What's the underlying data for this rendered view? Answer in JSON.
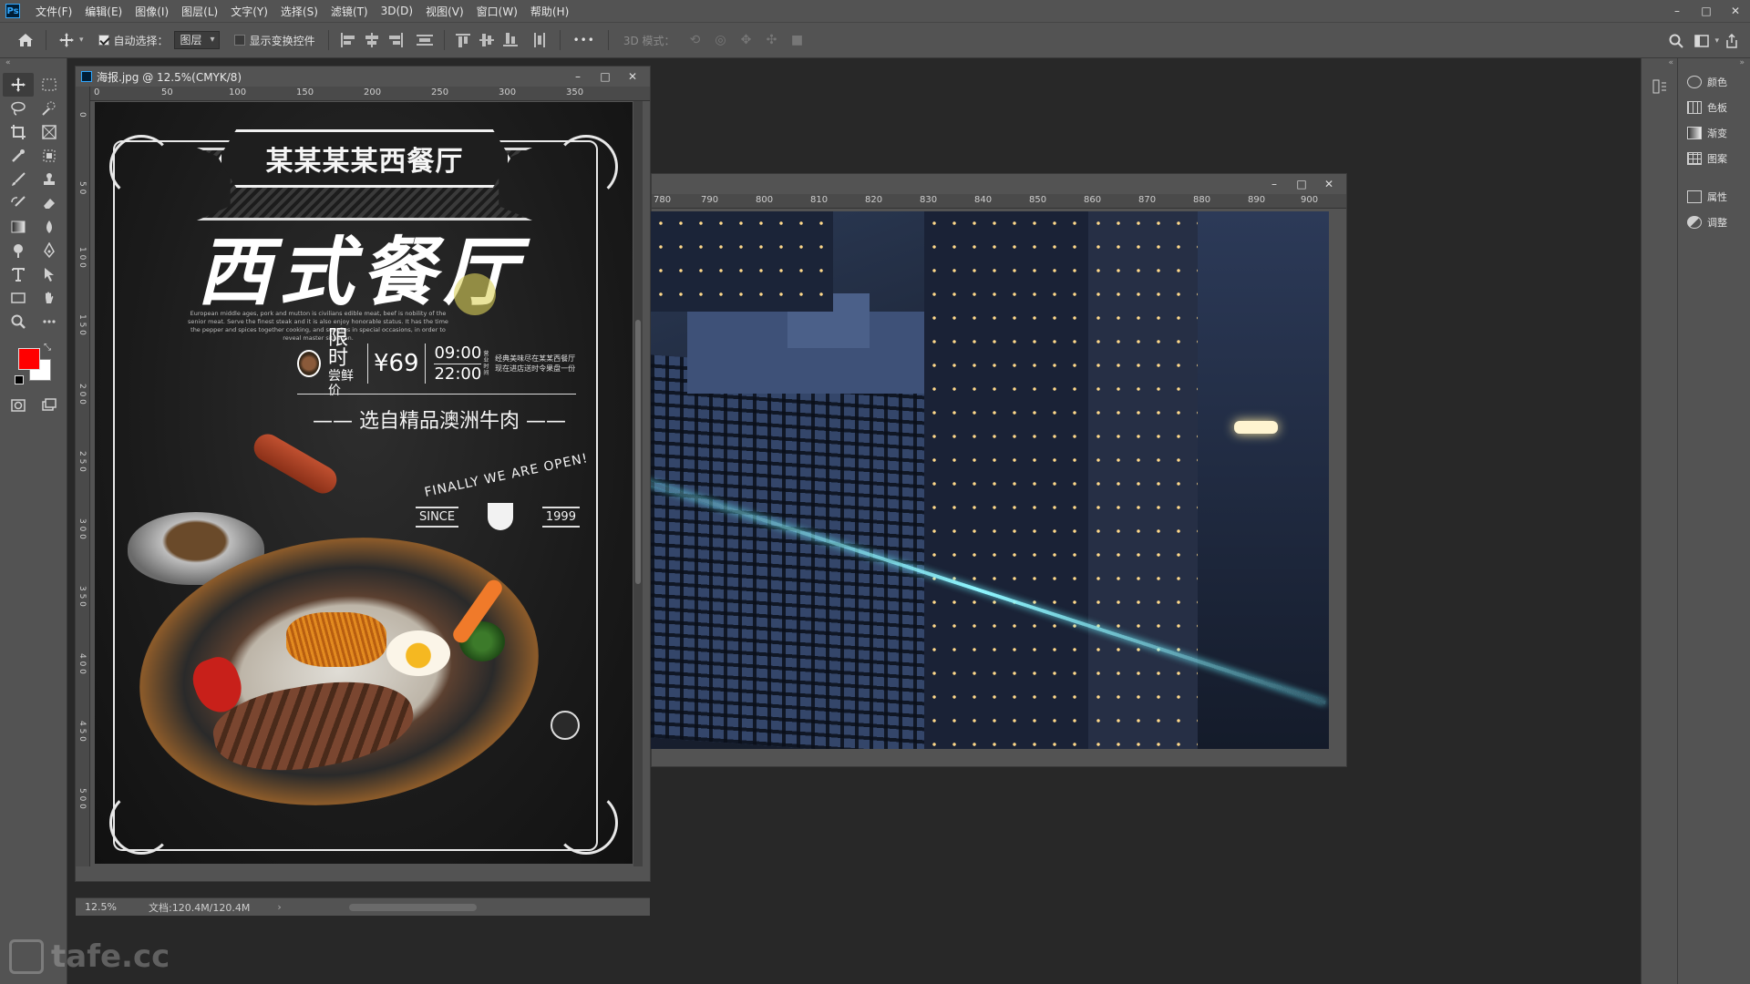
{
  "app": {
    "menus": [
      "文件(F)",
      "编辑(E)",
      "图像(I)",
      "图层(L)",
      "文字(Y)",
      "选择(S)",
      "滤镜(T)",
      "3D(D)",
      "视图(V)",
      "窗口(W)",
      "帮助(H)"
    ],
    "window_controls": [
      "–",
      "□",
      "✕"
    ],
    "logo_text": "Ps"
  },
  "options": {
    "auto_select_label": "自动选择：",
    "auto_select_checked": true,
    "target_value": "图层",
    "show_transform_label": "显示变换控件",
    "show_transform_checked": false,
    "more_label": "•••",
    "mode_3d_label": "3D 模式："
  },
  "tool_swatches": {
    "foreground": "#ff0000",
    "background": "#ffffff"
  },
  "document1": {
    "title": "海报.jpg @ 12.5%(CMYK/8)",
    "ruler_h": [
      "0",
      "50",
      "100",
      "150",
      "200",
      "250",
      "300",
      "350"
    ],
    "ruler_v": [
      "0",
      "5\n0",
      "1\n0\n0",
      "1\n5\n0",
      "2\n0\n0",
      "2\n5\n0",
      "3\n0\n0",
      "3\n5\n0",
      "4\n0\n0",
      "4\n5\n0",
      "5\n0\n0"
    ],
    "zoom": "12.5%",
    "doc_info": "文档:120.4M/120.4M",
    "poster": {
      "banner": "某某某某西餐厅",
      "title": "西式餐厅",
      "blurb": "European middle ages, pork and mutton is civilians edible meat, beef is nobility of the senior meat. Serve the finest steak and it is also enjoy honorable status. It has the time the pepper and spices together cooking, and supplies in special occasions, in order to reveal master situation.",
      "limited": "限时",
      "limited_sub": "尝鲜价",
      "price": "¥69",
      "open_time": "09:00",
      "close_time": "22:00",
      "tiny_vert": "营业时间",
      "note_line1": "经典美味尽在某某西餐厅",
      "note_line2": "现在进店送时令果盘一份",
      "subtitle": "—— 选自精品澳洲牛肉 ——",
      "opened": "FINALLY WE ARE OPEN!",
      "since": "SINCE",
      "year": "1999"
    }
  },
  "document2": {
    "ruler_h": [
      "780",
      "790",
      "800",
      "810",
      "820",
      "830",
      "840",
      "850",
      "860",
      "870",
      "880",
      "890",
      "900"
    ]
  },
  "dock": {
    "items": [
      "颜色",
      "色板",
      "渐变",
      "图案",
      "属性",
      "调整"
    ]
  },
  "watermark": "tafe.cc"
}
